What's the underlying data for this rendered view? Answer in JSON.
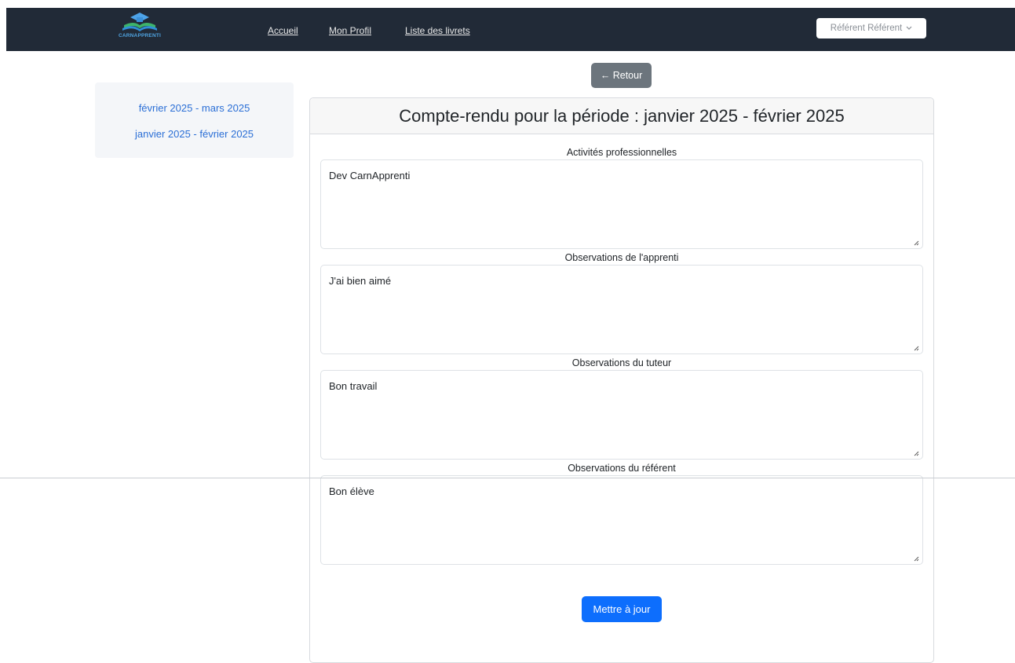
{
  "nav": {
    "brand": "CARNAPPRENTI",
    "links": [
      "Accueil",
      "Mon Profil",
      "Liste des livrets"
    ],
    "user": "Référent Référent"
  },
  "back_button": "← Retour",
  "sidebar": {
    "items": [
      "février 2025 - mars 2025",
      "janvier 2025 - février 2025"
    ]
  },
  "report": {
    "title": "Compte-rendu pour la période : janvier 2025 - février 2025",
    "fields": [
      {
        "label": "Activités professionnelles",
        "value": "Dev CarnApprenti"
      },
      {
        "label": "Observations de l'apprenti",
        "value": "J'ai bien aimé"
      },
      {
        "label": "Observations du tuteur",
        "value": "Bon travail"
      },
      {
        "label": "Observations du référent",
        "value": "Bon élève"
      }
    ],
    "submit": "Mettre à jour"
  },
  "colors": {
    "navbar": "#212a37",
    "link": "#2b6fd6",
    "primary": "#0d6efd",
    "secondary": "#6c757d"
  }
}
